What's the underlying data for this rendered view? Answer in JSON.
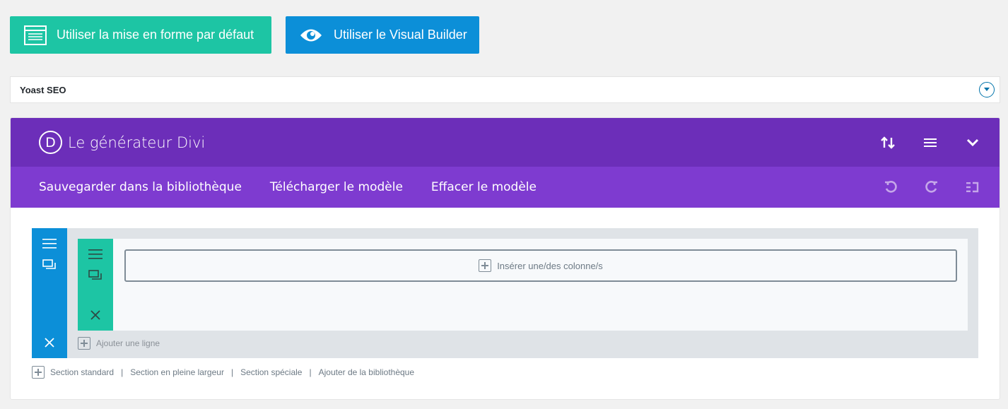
{
  "buttons": {
    "default_layout": {
      "label": "Utiliser la mise en forme par défaut",
      "icon": "layout-icon",
      "color": "#1dc5a4"
    },
    "visual_builder": {
      "label": "Utiliser le Visual Builder",
      "icon": "eye-icon",
      "color": "#0c8fd8"
    }
  },
  "yoast": {
    "title": "Yoast SEO",
    "toggle_icon": "chevron-down-circle-icon"
  },
  "divi": {
    "logo_letter": "D",
    "title": "Le générateur Divi",
    "header_color": "#6c2eb9",
    "toolbar_color": "#7e3bd0",
    "header_icons": [
      "sort-icon",
      "menu-icon",
      "chevron-down-icon"
    ],
    "toolbar": {
      "links": [
        "Sauvegarder dans la bibliothèque",
        "Télécharger le modèle",
        "Effacer le modèle"
      ],
      "icons": [
        "undo-icon",
        "redo-icon",
        "history-icon"
      ]
    },
    "section": {
      "color": "#0c8fd8",
      "icons": [
        "menu-icon",
        "duplicate-icon",
        "close-icon"
      ],
      "row": {
        "color": "#1dc5a4",
        "icons": [
          "menu-icon",
          "duplicate-icon",
          "close-icon"
        ],
        "insert_columns_label": "Insérer une/des colonne/s"
      },
      "add_row_label": "Ajouter une ligne"
    },
    "footer_links": [
      "Section standard",
      "Section en pleine largeur",
      "Section spéciale",
      "Ajouter de la bibliothèque"
    ]
  }
}
